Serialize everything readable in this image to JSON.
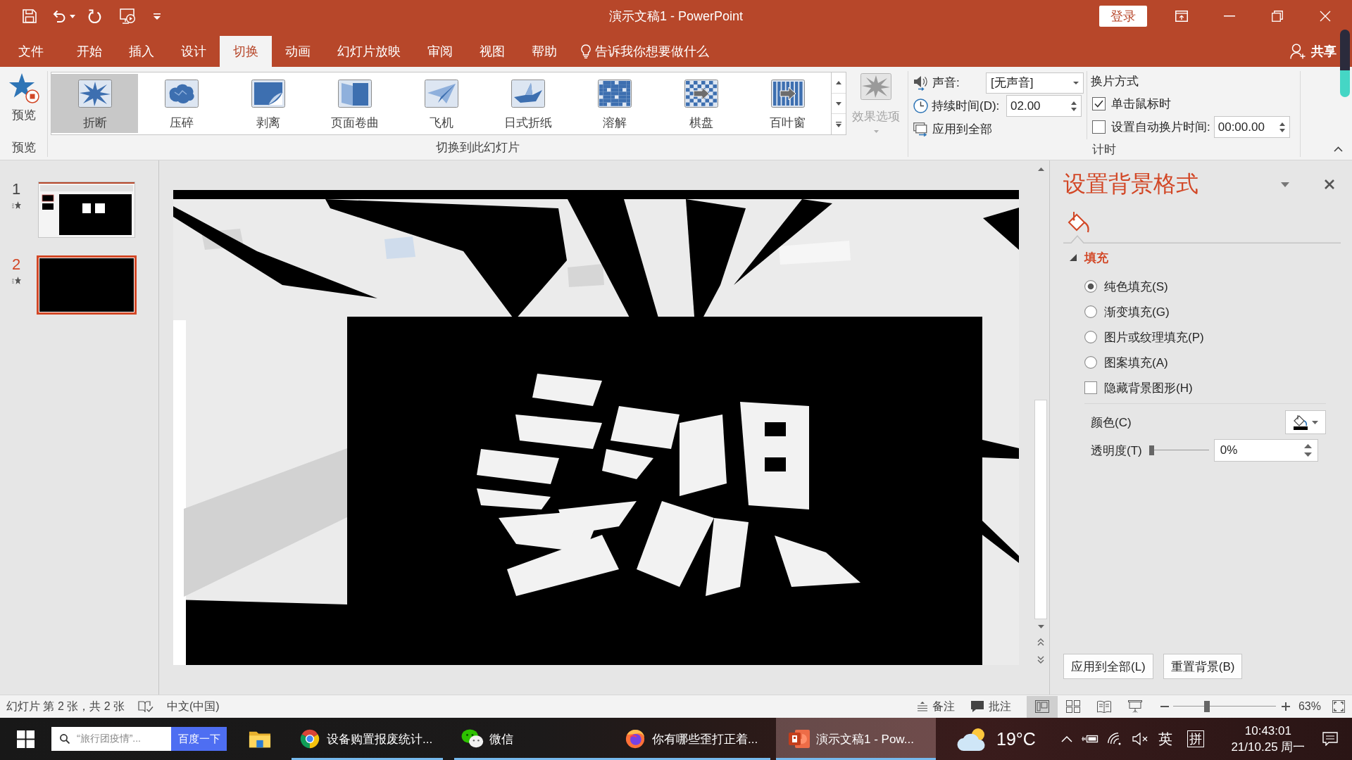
{
  "window": {
    "title": "演示文稿1 - PowerPoint",
    "sign_in": "登录"
  },
  "tabs": [
    {
      "label": "文件",
      "selected": false
    },
    {
      "label": "开始",
      "selected": false
    },
    {
      "label": "插入",
      "selected": false
    },
    {
      "label": "设计",
      "selected": false
    },
    {
      "label": "切换",
      "selected": true
    },
    {
      "label": "动画",
      "selected": false
    },
    {
      "label": "幻灯片放映",
      "selected": false
    },
    {
      "label": "审阅",
      "selected": false
    },
    {
      "label": "视图",
      "selected": false
    },
    {
      "label": "帮助",
      "selected": false
    }
  ],
  "tell_me": "告诉我你想要做什么",
  "share": "共享",
  "ribbon": {
    "preview": {
      "button": "预览",
      "group_label": "预览"
    },
    "transitions": {
      "items": [
        {
          "kind": "shatter",
          "label": "折断",
          "selected": true
        },
        {
          "kind": "crush",
          "label": "压碎",
          "selected": false
        },
        {
          "kind": "peel",
          "label": "剥离",
          "selected": false
        },
        {
          "kind": "curl",
          "label": "页面卷曲",
          "selected": false
        },
        {
          "kind": "airplane",
          "label": "飞机",
          "selected": false
        },
        {
          "kind": "origami",
          "label": "日式折纸",
          "selected": false
        },
        {
          "kind": "dissolve",
          "label": "溶解",
          "selected": false
        },
        {
          "kind": "checkerboard",
          "label": "棋盘",
          "selected": false
        },
        {
          "kind": "blinds",
          "label": "百叶窗",
          "selected": false
        }
      ],
      "effect_options": {
        "label": "效果选项",
        "disabled": true
      },
      "group_label": "切换到此幻灯片"
    },
    "timing": {
      "sound": {
        "label": "声音:",
        "value": "[无声音]"
      },
      "duration": {
        "label": "持续时间(D):",
        "value": "02.00"
      },
      "apply_all": "应用到全部",
      "advance_title": "换片方式",
      "on_click": {
        "label": "单击鼠标时",
        "checked": true
      },
      "after": {
        "label": "设置自动换片时间:",
        "checked": false,
        "value": "00:00.00"
      },
      "group_label": "计时"
    }
  },
  "slides_pane": {
    "slides": [
      {
        "number": "1",
        "kind": "picture",
        "selected": false
      },
      {
        "number": "2",
        "kind": "blank",
        "selected": true
      }
    ]
  },
  "format_pane": {
    "title": "设置背景格式",
    "section": {
      "label": "填充",
      "expanded": true
    },
    "fill_options": [
      {
        "label": "纯色填充(S)",
        "selected": true
      },
      {
        "label": "渐变填充(G)",
        "selected": false
      },
      {
        "label": "图片或纹理填充(P)",
        "selected": false
      },
      {
        "label": "图案填充(A)",
        "selected": false
      }
    ],
    "hide_background": {
      "label": "隐藏背景图形(H)",
      "checked": false
    },
    "color": {
      "label": "颜色(C)",
      "color": "#000000"
    },
    "transparency": {
      "label": "透明度(T)",
      "level": 0,
      "reading": "0%"
    },
    "buttons": [
      "应用到全部(L)",
      "重置背景(B)"
    ]
  },
  "status_bar": {
    "slide_info": "幻灯片 第 2 张，共 2 张",
    "language": "中文(中国)",
    "notes": "备注",
    "comments": "批注",
    "views": [
      {
        "kind": "normal",
        "selected": true
      },
      {
        "kind": "sorter",
        "selected": false
      },
      {
        "kind": "reading",
        "selected": false
      },
      {
        "kind": "slideshow",
        "selected": false
      }
    ],
    "zoom": {
      "level": 0.32,
      "reading": "63%"
    }
  },
  "taskbar": {
    "search": {
      "placeholder": "“旅行团疫情”...",
      "button": "百度一下"
    },
    "apps": [
      {
        "kind": "explorer",
        "running": false,
        "selected": false
      },
      {
        "kind": "chrome",
        "label": "设备购置报废统计...",
        "running": true,
        "selected": false
      },
      {
        "kind": "wechat",
        "label": "微信",
        "running": true,
        "selected": false
      },
      {
        "kind": "firefox",
        "label": "你有哪些歪打正着...",
        "running": true,
        "selected": false
      },
      {
        "kind": "powerpoint",
        "label": "演示文稿1 - Pow...",
        "running": true,
        "selected": true
      }
    ],
    "weather": "19°C",
    "tray": {
      "ime_language": "英",
      "ime_mode": "拼"
    },
    "clock": {
      "time": "10:43:01",
      "date": "21/10.25 周一"
    }
  }
}
